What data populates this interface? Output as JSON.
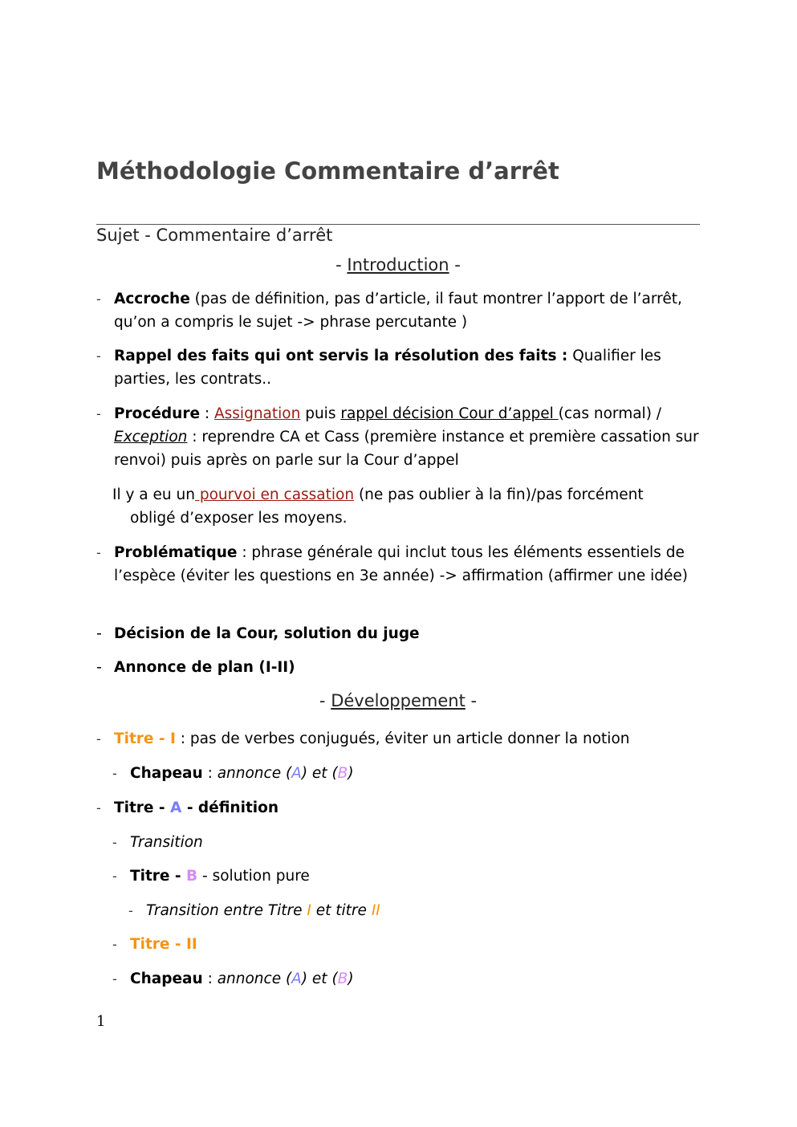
{
  "document": {
    "title": "Méthodologie Commentaire d’arrêt",
    "subject": "Sujet - Commentaire d’arrêt",
    "page_number": "1",
    "colors": {
      "title": "#444444",
      "link_red": "#9a1b12",
      "orange": "#f59412",
      "blue": "#7a7ff5",
      "purple": "#d88af7"
    }
  },
  "introduction": {
    "heading_prefix": "- ",
    "heading": "Introduction",
    "heading_suffix": " -",
    "accroche": {
      "label": "Accroche",
      "text": " (pas de définition, pas d’article, il faut montrer l’apport de l’arrêt, qu’on a compris le sujet -> phrase percutante )"
    },
    "rappel": {
      "label": "Rappel des faits qui ont servis la résolution des faits :",
      "text": " Qualifier les parties, les contrats.."
    },
    "procedure": {
      "label": "Procédure",
      "sep": " : ",
      "link1": "Assignation",
      "mid1": " puis ",
      "underlined": "rappel décision Cour d’appel ",
      "mid2": "(cas normal) / ",
      "exception": "Exception",
      "rest": " : reprendre CA et Cass (première instance et première cassation sur renvoi)  puis après on parle sur la Cour d’appel"
    },
    "pourvoi": {
      "pre": "Il y a eu un",
      "link": " pourvoi en cassation",
      "post": " (ne pas oublier à la fin)/pas forcément",
      "line2": "obligé d’exposer les moyens."
    },
    "problematique": {
      "label": "Problématique",
      "text": " : phrase générale qui inclut tous les éléments essentiels de l’espèce (éviter les questions en 3e année) -> affirmation (affirmer une idée)"
    },
    "decision": "Décision de la Cour, solution du juge",
    "annonce": "Annonce de plan (I-II)"
  },
  "developpement": {
    "heading_prefix": "- ",
    "heading": "Développement",
    "heading_suffix": " -",
    "titre1": {
      "label": "Titre - I",
      "text": " : pas de verbes conjugués, éviter un article donner la notion"
    },
    "chapeau1": {
      "label": "Chapeau",
      "sep": " : ",
      "t1": "annonce (",
      "a": "A",
      "t2": ") et (",
      "b": "B",
      "t3": ")"
    },
    "titreA": {
      "pre": "Titre - ",
      "letter": "A",
      "post": " - définition"
    },
    "transition": "Transition",
    "titreB": {
      "pre": "Titre - ",
      "letter": "B",
      "post": " - solution pure"
    },
    "transition2": {
      "t1": "Transition entre Titre ",
      "i": "I",
      "t2": " et titre ",
      "ii": "II"
    },
    "titre2": {
      "label": "Titre - II"
    },
    "chapeau2": {
      "label": "Chapeau",
      "sep": " : ",
      "t1": "annonce (",
      "a": "A",
      "t2": ") et (",
      "b": "B",
      "t3": ")"
    }
  }
}
